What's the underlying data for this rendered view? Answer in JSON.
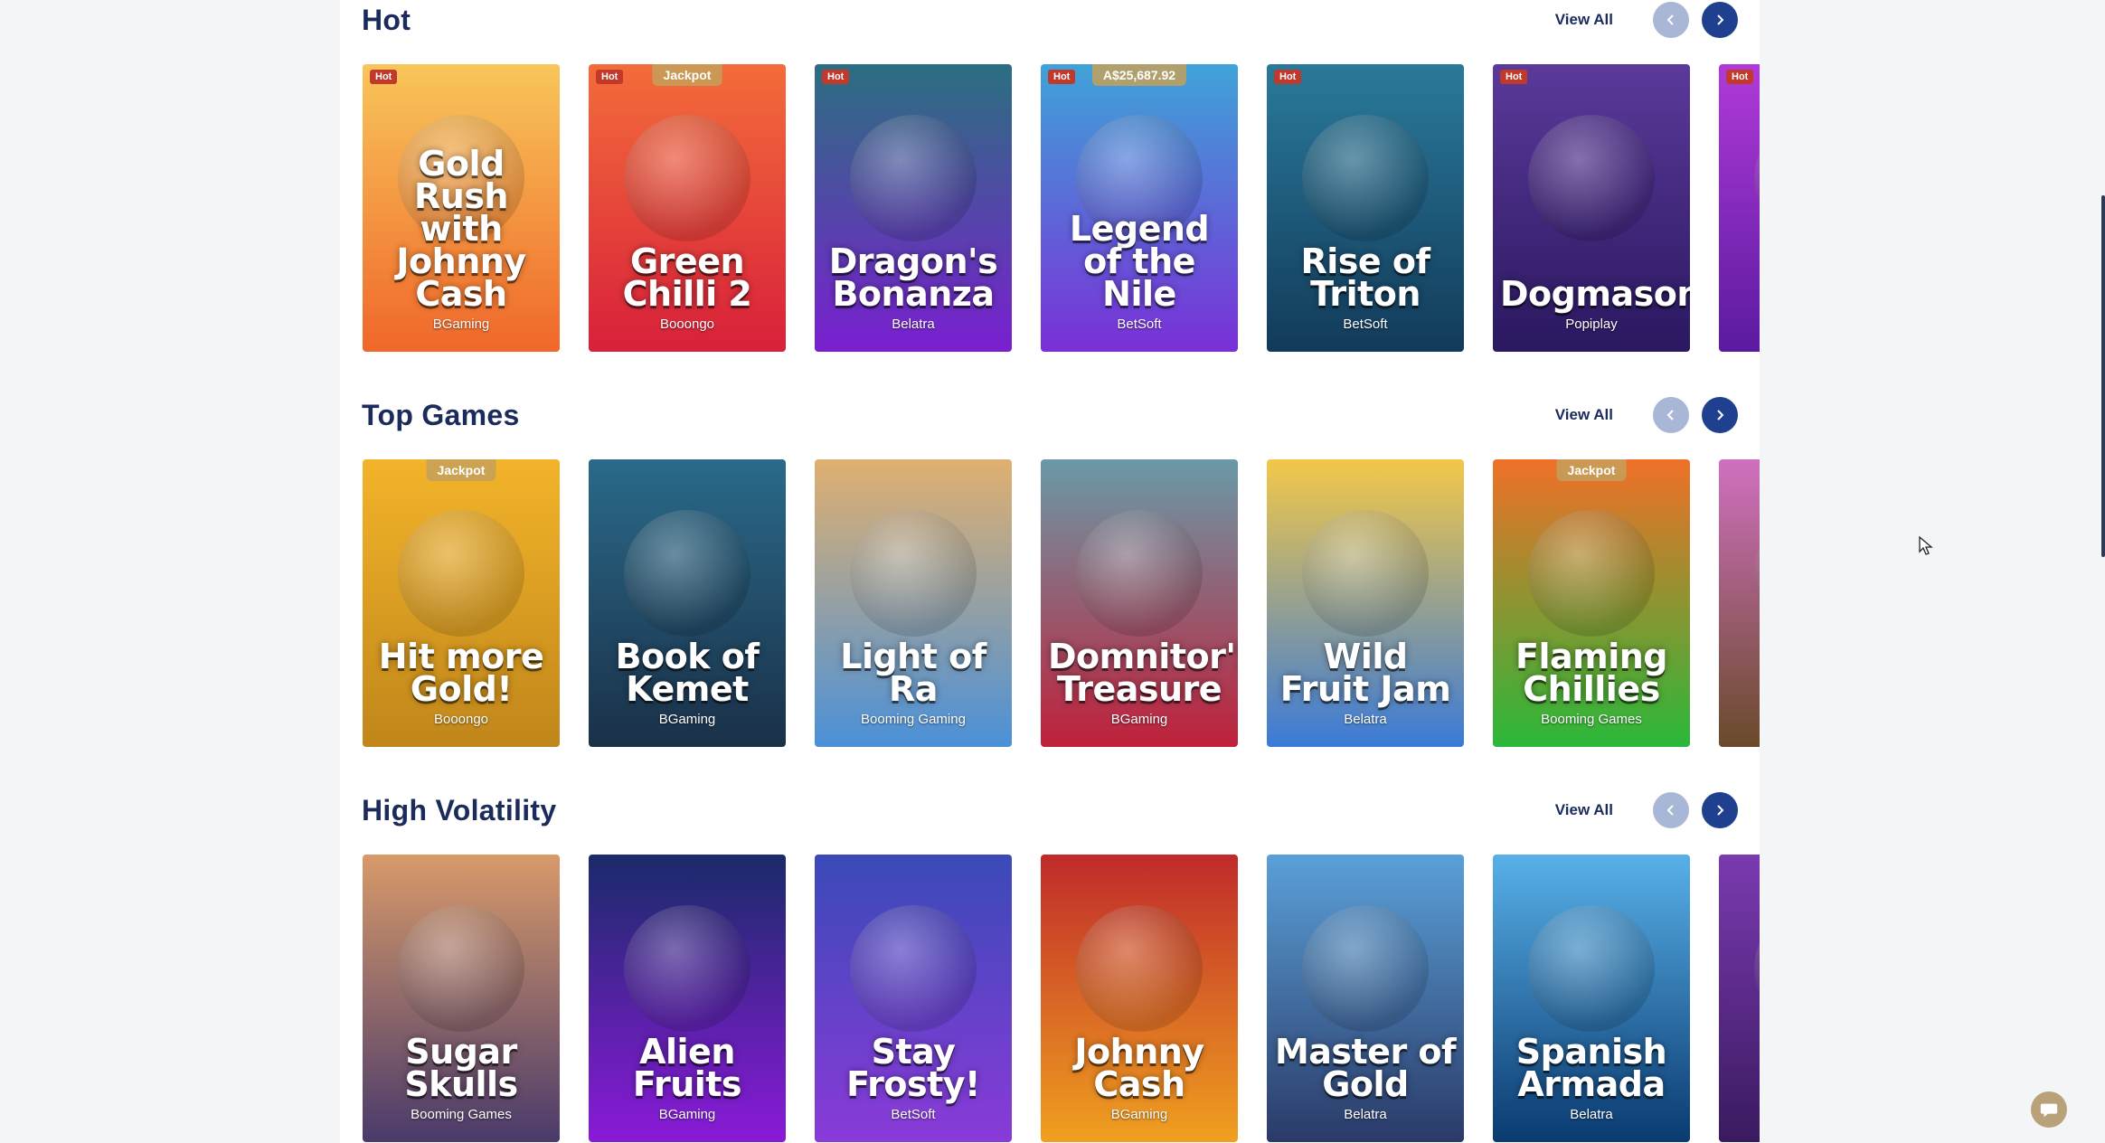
{
  "colors": {
    "title": "#1a2b5c",
    "arrow_prev": "#a9b7d6",
    "arrow_next": "#1f3f8f",
    "hot_badge": "#c0392b",
    "jackpot_badge": "#c4a05a"
  },
  "sections": [
    {
      "title": "Hot",
      "view_all": "View All",
      "prev_icon": "chevron-left-icon",
      "next_icon": "chevron-right-icon",
      "games": [
        {
          "title": "Gold Rush with Johnny Cash",
          "provider": "BGaming",
          "badge": "Hot",
          "top_badge": "",
          "gradient": "#f8c65a|#f0672a"
        },
        {
          "title": "Green Chilli 2",
          "provider": "Booongo",
          "badge": "Hot",
          "top_badge": "Jackpot",
          "gradient": "#f46c3a|#d8203a"
        },
        {
          "title": "Dragon's Bonanza",
          "provider": "Belatra",
          "badge": "Hot",
          "top_badge": "",
          "gradient": "#2b6f80|#7a1fd0"
        },
        {
          "title": "Legend of the Nile",
          "provider": "BetSoft",
          "badge": "Hot",
          "top_badge": "A$25,687.92",
          "gradient": "#3fa3d8|#7a2fd8"
        },
        {
          "title": "Rise of Triton",
          "provider": "BetSoft",
          "badge": "Hot",
          "top_badge": "",
          "gradient": "#2a7a9a|#123a5a"
        },
        {
          "title": "Dogmasons",
          "provider": "Popiplay",
          "badge": "Hot",
          "top_badge": "",
          "gradient": "#5b3a9a|#2a1860"
        },
        {
          "title": "",
          "provider": "",
          "badge": "Hot",
          "top_badge": "",
          "gradient": "#b03ad8|#5a1aa0"
        }
      ]
    },
    {
      "title": "Top Games",
      "view_all": "View All",
      "prev_icon": "chevron-left-icon",
      "next_icon": "chevron-right-icon",
      "games": [
        {
          "title": "Hit more Gold!",
          "provider": "Booongo",
          "badge": "",
          "top_badge": "Jackpot",
          "gradient": "#f3b42a|#c0861a"
        },
        {
          "title": "Book of Kemet",
          "provider": "BGaming",
          "badge": "",
          "top_badge": "",
          "gradient": "#2a6a8a|#1a3048"
        },
        {
          "title": "Light of Ra",
          "provider": "Booming Gaming",
          "badge": "",
          "top_badge": "",
          "gradient": "#e0b070|#4a90d8"
        },
        {
          "title": "Domnitor'S Treasure",
          "provider": "BGaming",
          "badge": "",
          "top_badge": "",
          "gradient": "#6a9aa8|#c0203a"
        },
        {
          "title": "Wild Fruit Jam",
          "provider": "Belatra",
          "badge": "",
          "top_badge": "",
          "gradient": "#f3c848|#3a7ad8"
        },
        {
          "title": "Flaming Chillies",
          "provider": "Booming Games",
          "badge": "",
          "top_badge": "Jackpot",
          "gradient": "#f07028|#2ab83a"
        },
        {
          "title": "",
          "provider": "",
          "badge": "",
          "top_badge": "",
          "gradient": "#d070c0|#6a4a2a"
        }
      ]
    },
    {
      "title": "High Volatility",
      "view_all": "View All",
      "prev_icon": "chevron-left-icon",
      "next_icon": "chevron-right-icon",
      "games": [
        {
          "title": "Sugar Skulls",
          "provider": "Booming Games",
          "badge": "",
          "top_badge": "",
          "gradient": "#d89a6a|#4a3a6a"
        },
        {
          "title": "Alien Fruits",
          "provider": "BGaming",
          "badge": "",
          "top_badge": "",
          "gradient": "#1a2a6a|#8a1ad8"
        },
        {
          "title": "Stay Frosty!",
          "provider": "BetSoft",
          "badge": "",
          "top_badge": "",
          "gradient": "#3a4ab8|#8a3ad8"
        },
        {
          "title": "Johnny Cash",
          "provider": "BGaming",
          "badge": "",
          "top_badge": "",
          "gradient": "#c02a2a|#f0a020"
        },
        {
          "title": "Master of Gold",
          "provider": "Belatra",
          "badge": "",
          "top_badge": "",
          "gradient": "#5aa0d8|#2a3a68"
        },
        {
          "title": "Spanish Armada",
          "provider": "Belatra",
          "badge": "",
          "top_badge": "",
          "gradient": "#58b0e8|#0a3a70"
        },
        {
          "title": "",
          "provider": "",
          "badge": "",
          "top_badge": "",
          "gradient": "#7a3ab0|#3a1a60"
        }
      ]
    }
  ],
  "chat": {
    "icon": "chat-bubble-icon"
  }
}
